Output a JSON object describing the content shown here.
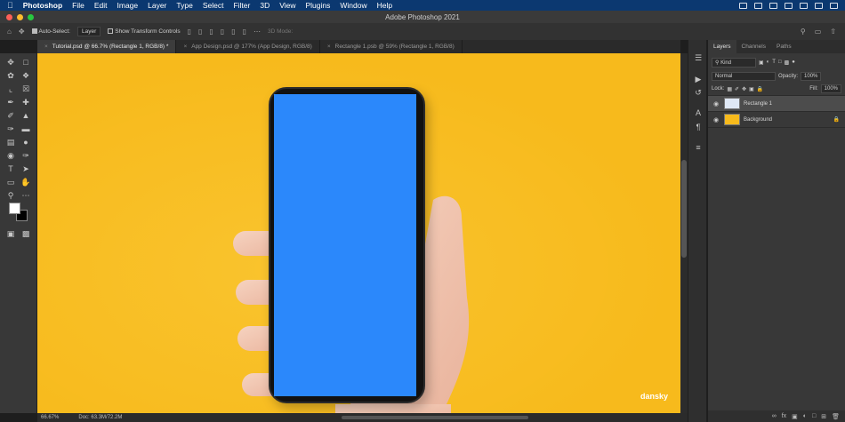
{
  "menubar": {
    "app": "Photoshop",
    "items": [
      "File",
      "Edit",
      "Image",
      "Layer",
      "Type",
      "Select",
      "Filter",
      "3D",
      "View",
      "Plugins",
      "Window",
      "Help"
    ]
  },
  "window": {
    "title": "Adobe Photoshop 2021"
  },
  "options": {
    "auto_select": "Auto-Select:",
    "auto_select_target": "Layer",
    "show_transform": "Show Transform Controls",
    "mode_3d": "3D Mode:"
  },
  "tabs": [
    {
      "label": "Tutorial.psd @ 66.7% (Rectangle 1, RGB/8) *"
    },
    {
      "label": "App Design.psd @ 177% (App Design, RGB/8)"
    },
    {
      "label": "Rectangle 1.psb @ 59% (Rectangle 1, RGB/8)"
    }
  ],
  "status": {
    "zoom": "66.67%",
    "doc": "Doc: 63.3M/72.2M"
  },
  "layers_panel": {
    "tabs": [
      "Layers",
      "Channels",
      "Paths"
    ],
    "filter": "Kind",
    "blend_mode": "Normal",
    "opacity_label": "Opacity:",
    "opacity_value": "100%",
    "lock_label": "Lock:",
    "fill_label": "Fill:",
    "fill_value": "100%",
    "layers": [
      {
        "name": "Rectangle 1",
        "selected": true
      },
      {
        "name": "Background",
        "selected": false
      }
    ]
  },
  "colors": {
    "canvas": "#f7ba1c",
    "screen": "#2b88fb",
    "menubar": "#0b3870"
  },
  "watermark": "dansky"
}
